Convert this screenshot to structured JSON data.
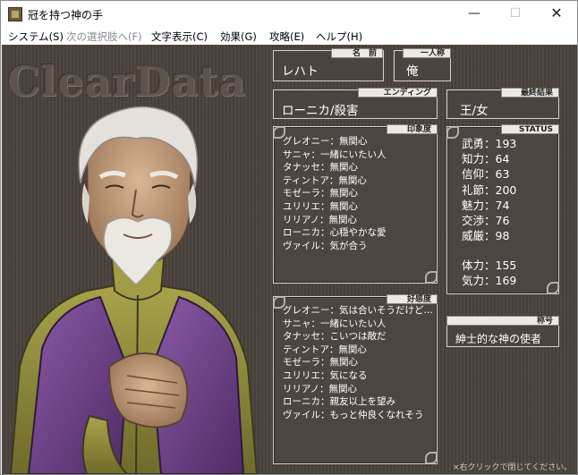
{
  "window": {
    "title": "冠を持つ神の手",
    "minimize_glyph": "—",
    "maximize_glyph": "☐",
    "close_glyph": "✕"
  },
  "menu": [
    {
      "label": "システム(S)",
      "enabled": true
    },
    {
      "label": "次の選択肢へ(F)",
      "enabled": false
    },
    {
      "label": "文字表示(C)",
      "enabled": true
    },
    {
      "label": "効果(G)",
      "enabled": true
    },
    {
      "label": "攻略(E)",
      "enabled": true
    },
    {
      "label": "ヘルプ(H)",
      "enabled": true
    }
  ],
  "logo": "ClearData",
  "name": {
    "tag": "名　前",
    "value": "レハト"
  },
  "pronoun": {
    "tag": "一人称",
    "value": "俺"
  },
  "ending": {
    "tag": "エンディング",
    "value": "ローニカ/殺害"
  },
  "final_result": {
    "tag": "最終結果",
    "value": "王/女"
  },
  "impression": {
    "tag": "印象度",
    "rows": [
      "グレオニー：無関心",
      "サニャ：一緒にいたい人",
      "タナッセ：無関心",
      "ティントア：無関心",
      "モゼーラ：無関心",
      "ユリリエ：無関心",
      "リリアノ：無関心",
      "ローニカ：心穏やかな愛",
      "ヴァイル：気が合う"
    ]
  },
  "affinity": {
    "tag": "好感度",
    "rows": [
      "グレオニー：気は合いそうだけど…",
      "サニャ：一緒にいたい人",
      "タナッセ：こいつは敵だ",
      "ティントア：無関心",
      "モゼーラ：無関心",
      "ユリリエ：気になる",
      "リリアノ：無関心",
      "ローニカ：親友以上を望み",
      "ヴァイル：もっと仲良くなれそう"
    ]
  },
  "status": {
    "tag": "STATUS",
    "rows": [
      "武勇：193",
      "知力：64",
      "信仰：63",
      "礼節：200",
      "魅力：74",
      "交渉：76",
      "威厳：98"
    ],
    "rows2": [
      "体力：155",
      "気力：169"
    ]
  },
  "title_field": {
    "tag": "称号",
    "value": "紳士的な神の使者"
  },
  "footer": "×右クリックで閉じてください。",
  "colors": {
    "background": "#4a423c",
    "panel_border": "#d7d2cb",
    "tag_bg": "#ece9e4",
    "text": "#ffffff"
  }
}
